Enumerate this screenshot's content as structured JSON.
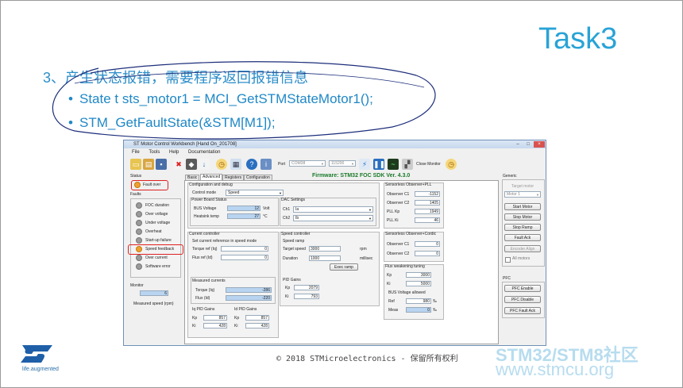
{
  "slide": {
    "title": "Task3",
    "point3": "3、产生状态报错，需要程序返回报错信息",
    "bullets": [
      "State t sts_motor1 = MCI_GetSTMStateMotor1();",
      "STM_GetFaultState(&STM[M1]);"
    ],
    "bullet_char": "•",
    "footer": "© 2018 STMicroelectronics - 保留所有权利",
    "logo_tagline": "life.augmented",
    "brand_line1": "STM32/STM8社区",
    "brand_line2": "www.stmcu.org"
  },
  "app": {
    "window_title": "ST Motor Control Workbench [Hand On_201708]",
    "menu": [
      "File",
      "Tools",
      "Help",
      "Documentation"
    ],
    "port_label": "Port",
    "port_value": "COM38",
    "baud_value": "115200",
    "close_monitor": "Close Monitor",
    "firmware": "Firmware: STM32 FOC SDK Ver. 4.3.0",
    "tabs": [
      "Basic",
      "Advanced",
      "Registers",
      "Configuration"
    ],
    "status": {
      "heading": "Status",
      "value": "Fault over"
    },
    "faults": {
      "heading": "Faults",
      "items": [
        "FOC duration",
        "Over voltage",
        "Under voltage",
        "Overheat",
        "Start-up failure",
        "Speed feedback",
        "Over current",
        "Software error"
      ]
    },
    "monitor": {
      "heading": "Monitor",
      "value": "6",
      "label": "Measured speed (rpm)"
    },
    "config_debug": {
      "heading": "Configuration and debug",
      "control_mode_label": "Control mode",
      "control_mode_value": "Speed"
    },
    "power_board": {
      "heading": "Power Board Status",
      "bus_label": "BUS Voltage",
      "bus_value": "12",
      "bus_unit": "Volt",
      "heat_label": "Heatsink temp",
      "heat_value": "27",
      "heat_unit": "°C"
    },
    "dac": {
      "heading": "DAC Settings",
      "ch1_label": "Ch1",
      "ch1_value": "Ia",
      "ch2_label": "Ch2",
      "ch2_value": "Ib"
    },
    "current_ctrl": {
      "heading": "Current controller",
      "sub": "Set current reference in speed mode",
      "torque_label": "Torque ref (Iq)",
      "torque_value": "0",
      "flux_label": "Flux ref (Id)",
      "flux_value": "0"
    },
    "measured": {
      "heading": "Measured currents",
      "torque_label": "Torque (Iq)",
      "torque_value": "-286",
      "flux_label": "Flux (Id)",
      "flux_value": "-220"
    },
    "iq_pid": {
      "heading": "Iq PID Gains",
      "kp": "857",
      "ki": "428"
    },
    "id_pid": {
      "heading": "Id PID Gains",
      "kp": "857",
      "ki": "428"
    },
    "kp_label": "Kp",
    "ki_label": "Ki",
    "speed_ctrl": {
      "heading": "Speed controller",
      "ramp": "Speed ramp",
      "target_label": "Target speed",
      "target_value": "3000",
      "target_unit": "rpm",
      "duration_label": "Duration",
      "duration_value": "1000",
      "duration_unit": "millisec",
      "exec_button": "Exec ramp"
    },
    "pid_gains": {
      "heading": "PID Gains",
      "kp": "2079",
      "ki": "793"
    },
    "sensorless_pll": {
      "heading": "Sensorless Observer+PLL",
      "c1_label": "Observer C1",
      "c1": "-1152",
      "c2_label": "Observer C2",
      "c2": "1405",
      "kp_label": "PLL Kp",
      "kp": "1949",
      "ki_label": "PLL Ki",
      "ki": "46"
    },
    "sensorless_cordic": {
      "heading": "Sensorless Observer+Cordic",
      "c1_label": "Observer C1",
      "c1": "0",
      "c2_label": "Observer C2",
      "c2": "0"
    },
    "flux_weak": {
      "heading": "Flux weakening tuning",
      "kp": "3000",
      "ki": "5000",
      "bus_allowed": "BUS Voltage allowed",
      "ref_label": "Ref",
      "ref_value": "980",
      "ref_unit": "‰",
      "meas_label": "Meas",
      "meas_value": "0",
      "meas_unit": "‰"
    },
    "generic": {
      "heading": "Generic",
      "target_motor": "Target motor",
      "motor_value": "Motor 1",
      "buttons": [
        "Start Motor",
        "Stop Motor",
        "Stop Ramp",
        "Fault Ack",
        "Encoder Align"
      ],
      "all_motors": "All motors"
    },
    "pfc": {
      "heading": "PFC",
      "buttons": [
        "PFC Enable",
        "PFC Disable",
        "PFC Fault Ack"
      ]
    }
  },
  "colors": {
    "title": "#29a3d6",
    "accent": "#1f88c6",
    "firmware": "#1a7a2a",
    "highlight": "#e02020"
  }
}
